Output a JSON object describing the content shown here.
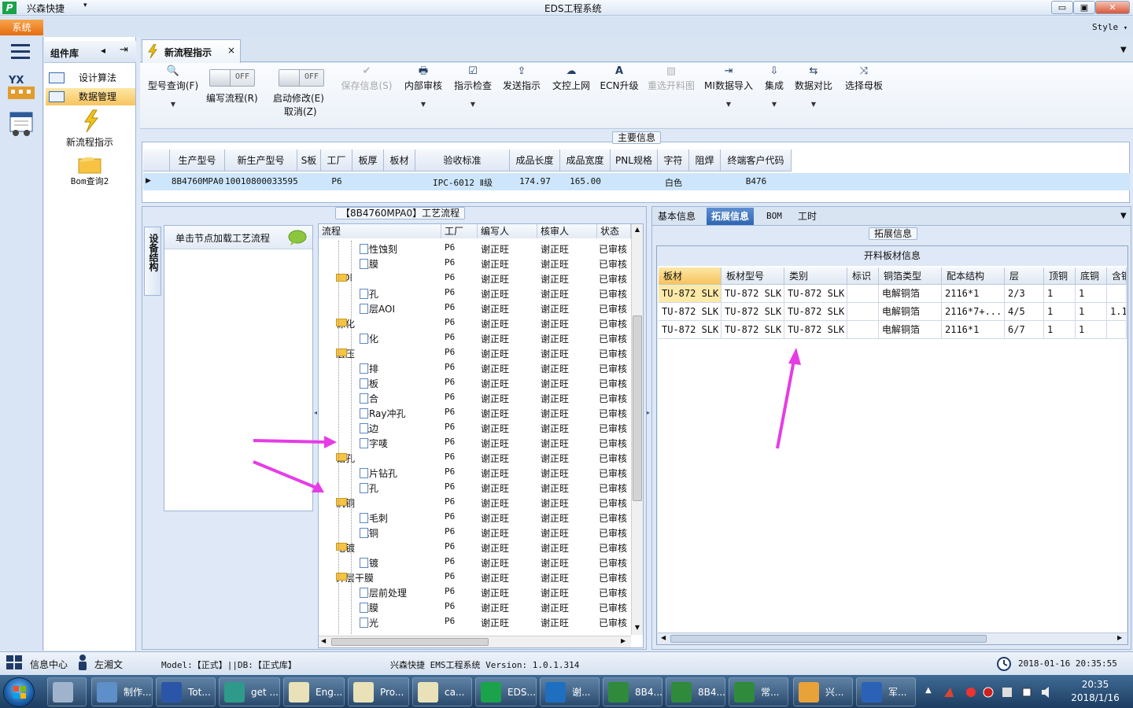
{
  "window": {
    "app_name": "兴森快捷",
    "title": "EDS工程系统",
    "style_label": "Style",
    "minimize": "▭",
    "maximize": "▣",
    "close": "✕"
  },
  "menu": {
    "system_tab": "系统"
  },
  "left_strip": {
    "logo_text": "YX"
  },
  "component_panel": {
    "title": "组件库",
    "items": [
      {
        "label": "设计算法"
      },
      {
        "label": "数据管理"
      }
    ],
    "tools": [
      {
        "label": "新流程指示"
      },
      {
        "label": "Bom查询2"
      }
    ]
  },
  "doc_tab": {
    "label": "新流程指示",
    "close": "×"
  },
  "ribbon": {
    "buttons": [
      {
        "label": "型号查询(F)",
        "icon": "search-icon",
        "glyph": "🔍",
        "disabled": false
      },
      {
        "label": "保存信息(S)",
        "icon": "check-icon",
        "glyph": "✔",
        "disabled": true
      },
      {
        "label": "内部审核",
        "icon": "printer-icon",
        "glyph": "🖶",
        "disabled": false
      },
      {
        "label": "指示检查",
        "icon": "checkbox-icon",
        "glyph": "☑",
        "disabled": false
      },
      {
        "label": "发送指示",
        "icon": "upload-icon",
        "glyph": "⇪",
        "disabled": false
      },
      {
        "label": "文控上网",
        "icon": "cloud-upload-icon",
        "glyph": "☁",
        "disabled": false
      },
      {
        "label": "ECN升级",
        "icon": "ecn-icon",
        "glyph": "A",
        "disabled": false
      },
      {
        "label": "重选开料图",
        "icon": "image-icon",
        "glyph": "▨",
        "disabled": true
      },
      {
        "label": "MI数据导入",
        "icon": "import-icon",
        "glyph": "⇥",
        "disabled": false
      },
      {
        "label": "集成",
        "icon": "download-icon",
        "glyph": "⇩",
        "disabled": false
      },
      {
        "label": "数据对比",
        "icon": "compare-icon",
        "glyph": "⇆",
        "disabled": false
      },
      {
        "label": "选择母板",
        "icon": "shuffle-icon",
        "glyph": "⤨",
        "disabled": false
      }
    ],
    "toggle_edit": {
      "state": "OFF",
      "label": "编写流程(R)"
    },
    "toggle_start": {
      "state": "OFF",
      "label": "启动修改(E)",
      "label2": "取消(Z)"
    }
  },
  "main_info": {
    "title": "主要信息",
    "columns": [
      "生产型号",
      "新生产型号",
      "S板",
      "工厂",
      "板厚",
      "板材",
      "验收标准",
      "成品长度",
      "成品宽度",
      "PNL规格",
      "字符",
      "阻焊",
      "终端客户代码"
    ],
    "row": [
      "8B4760MPA0",
      "10010800033595",
      "",
      "P6",
      "",
      "",
      "IPC-6012 Ⅱ级",
      "174.97",
      "165.00",
      "",
      "白色",
      "",
      "B476"
    ]
  },
  "process_panel": {
    "title": "【8B4760MPA0】工艺流程",
    "side_tab": "设备结构",
    "node_hint": "单击节点加载工艺流程",
    "columns": [
      "流程",
      "工厂",
      "编写人",
      "核审人",
      "状态"
    ],
    "rows": [
      {
        "name": "酸性蚀刻",
        "type": "doc",
        "factory": "P6",
        "writer": "谢正旺",
        "reviewer": "谢正旺",
        "status": "已审核"
      },
      {
        "name": "退膜",
        "type": "doc",
        "factory": "P6",
        "writer": "谢正旺",
        "reviewer": "谢正旺",
        "status": "已审核"
      },
      {
        "name": "AOI",
        "type": "folder",
        "factory": "P6",
        "writer": "谢正旺",
        "reviewer": "谢正旺",
        "status": "已审核"
      },
      {
        "name": "冲孔",
        "type": "doc",
        "factory": "P6",
        "writer": "谢正旺",
        "reviewer": "谢正旺",
        "status": "已审核"
      },
      {
        "name": "内层AOI",
        "type": "doc",
        "factory": "P6",
        "writer": "谢正旺",
        "reviewer": "谢正旺",
        "status": "已审核"
      },
      {
        "name": "棕化",
        "type": "folder",
        "factory": "P6",
        "writer": "谢正旺",
        "reviewer": "谢正旺",
        "status": "已审核"
      },
      {
        "name": "棕化",
        "type": "doc",
        "factory": "P6",
        "writer": "谢正旺",
        "reviewer": "谢正旺",
        "status": "已审核"
      },
      {
        "name": "层压",
        "type": "folder",
        "factory": "P6",
        "writer": "谢正旺",
        "reviewer": "谢正旺",
        "status": "已审核"
      },
      {
        "name": "预排",
        "type": "doc",
        "factory": "P6",
        "writer": "谢正旺",
        "reviewer": "谢正旺",
        "status": "已审核"
      },
      {
        "name": "排板",
        "type": "doc",
        "factory": "P6",
        "writer": "谢正旺",
        "reviewer": "谢正旺",
        "status": "已审核"
      },
      {
        "name": "压合",
        "type": "doc",
        "factory": "P6",
        "writer": "谢正旺",
        "reviewer": "谢正旺",
        "status": "已审核"
      },
      {
        "name": "X-Ray冲孔",
        "type": "doc",
        "factory": "P6",
        "writer": "谢正旺",
        "reviewer": "谢正旺",
        "status": "已审核"
      },
      {
        "name": "铣边",
        "type": "doc",
        "factory": "P6",
        "writer": "谢正旺",
        "reviewer": "谢正旺",
        "status": "已审核"
      },
      {
        "name": "打字唛",
        "type": "doc",
        "factory": "P6",
        "writer": "谢正旺",
        "reviewer": "谢正旺",
        "status": "已审核"
      },
      {
        "name": "钻孔",
        "type": "folder",
        "factory": "P6",
        "writer": "谢正旺",
        "reviewer": "谢正旺",
        "status": "已审核"
      },
      {
        "name": "铝片钻孔",
        "type": "doc",
        "factory": "P6",
        "writer": "谢正旺",
        "reviewer": "谢正旺",
        "status": "已审核"
      },
      {
        "name": "钻孔",
        "type": "doc",
        "factory": "P6",
        "writer": "谢正旺",
        "reviewer": "谢正旺",
        "status": "已审核"
      },
      {
        "name": "沉铜",
        "type": "folder",
        "factory": "P6",
        "writer": "谢正旺",
        "reviewer": "谢正旺",
        "status": "已审核"
      },
      {
        "name": "去毛刺",
        "type": "doc",
        "factory": "P6",
        "writer": "谢正旺",
        "reviewer": "谢正旺",
        "status": "已审核"
      },
      {
        "name": "沉铜",
        "type": "doc",
        "factory": "P6",
        "writer": "谢正旺",
        "reviewer": "谢正旺",
        "status": "已审核"
      },
      {
        "name": "电镀",
        "type": "folder",
        "factory": "P6",
        "writer": "谢正旺",
        "reviewer": "谢正旺",
        "status": "已审核"
      },
      {
        "name": "板镀",
        "type": "doc",
        "factory": "P6",
        "writer": "谢正旺",
        "reviewer": "谢正旺",
        "status": "已审核"
      },
      {
        "name": "外层干膜",
        "type": "folder",
        "factory": "P6",
        "writer": "谢正旺",
        "reviewer": "谢正旺",
        "status": "已审核"
      },
      {
        "name": "外层前处理",
        "type": "doc",
        "factory": "P6",
        "writer": "谢正旺",
        "reviewer": "谢正旺",
        "status": "已审核"
      },
      {
        "name": "贴膜",
        "type": "doc",
        "factory": "P6",
        "writer": "谢正旺",
        "reviewer": "谢正旺",
        "status": "已审核"
      },
      {
        "name": "曝光",
        "type": "doc",
        "factory": "P6",
        "writer": "谢正旺",
        "reviewer": "谢正旺",
        "status": "已审核"
      }
    ]
  },
  "right_panel": {
    "tabs": [
      "基本信息",
      "拓展信息",
      "BOM",
      "工时"
    ],
    "group_title": "拓展信息",
    "grid_title": "开料板材信息",
    "columns": [
      "板材",
      "板材型号",
      "类别",
      "标识",
      "铜箔类型",
      "配本结构",
      "层",
      "顶铜",
      "底铜",
      "含铜"
    ],
    "rows": [
      [
        "TU-872 SLK",
        "TU-872 SLK",
        "TU-872 SLK",
        "",
        "电解铜箔",
        "2116*1",
        "2/3",
        "1",
        "1",
        ""
      ],
      [
        "TU-872 SLK",
        "TU-872 SLK",
        "TU-872 SLK",
        "",
        "电解铜箔",
        "2116*7+...",
        "4/5",
        "1",
        "1",
        "1.1"
      ],
      [
        "TU-872 SLK",
        "TU-872 SLK",
        "TU-872 SLK",
        "",
        "电解铜箔",
        "2116*1",
        "6/7",
        "1",
        "1",
        ""
      ]
    ]
  },
  "status_bar": {
    "info_center": "信息中心",
    "user": "左湘文",
    "model": "Model:【正式】||DB:【正式库】",
    "system": "兴森快捷 EMS工程系统 Version: 1.0.1.314",
    "datetime": "2018-01-16 20:35:55"
  },
  "taskbar": {
    "items": [
      {
        "label": "",
        "color": "#9fb4cc"
      },
      {
        "label": "制作...",
        "color": "#5f8fc9"
      },
      {
        "label": "Tot...",
        "color": "#2b56a8"
      },
      {
        "label": "get ...",
        "color": "#2f9a8a"
      },
      {
        "label": "Eng...",
        "color": "#e9e2b8"
      },
      {
        "label": "Pro...",
        "color": "#e9e2b8"
      },
      {
        "label": "ca...",
        "color": "#e9e2b8"
      },
      {
        "label": "EDS...",
        "color": "#1aa34a"
      },
      {
        "label": "谢...",
        "color": "#1e6fc0"
      },
      {
        "label": "8B4...",
        "color": "#2f8a3c"
      },
      {
        "label": "8B4...",
        "color": "#2f8a3c"
      },
      {
        "label": "常...",
        "color": "#2f8a3c"
      },
      {
        "label": "兴...",
        "color": "#e8a23a"
      },
      {
        "label": "军...",
        "color": "#2b62b8"
      }
    ],
    "time": "20:35",
    "date": "2018/1/16"
  },
  "colors": {
    "accent": "#2f65b0",
    "selected_row": "#cde6fb",
    "annotation_arrow": "#e63ce6",
    "active_component": "#f7c45e"
  }
}
